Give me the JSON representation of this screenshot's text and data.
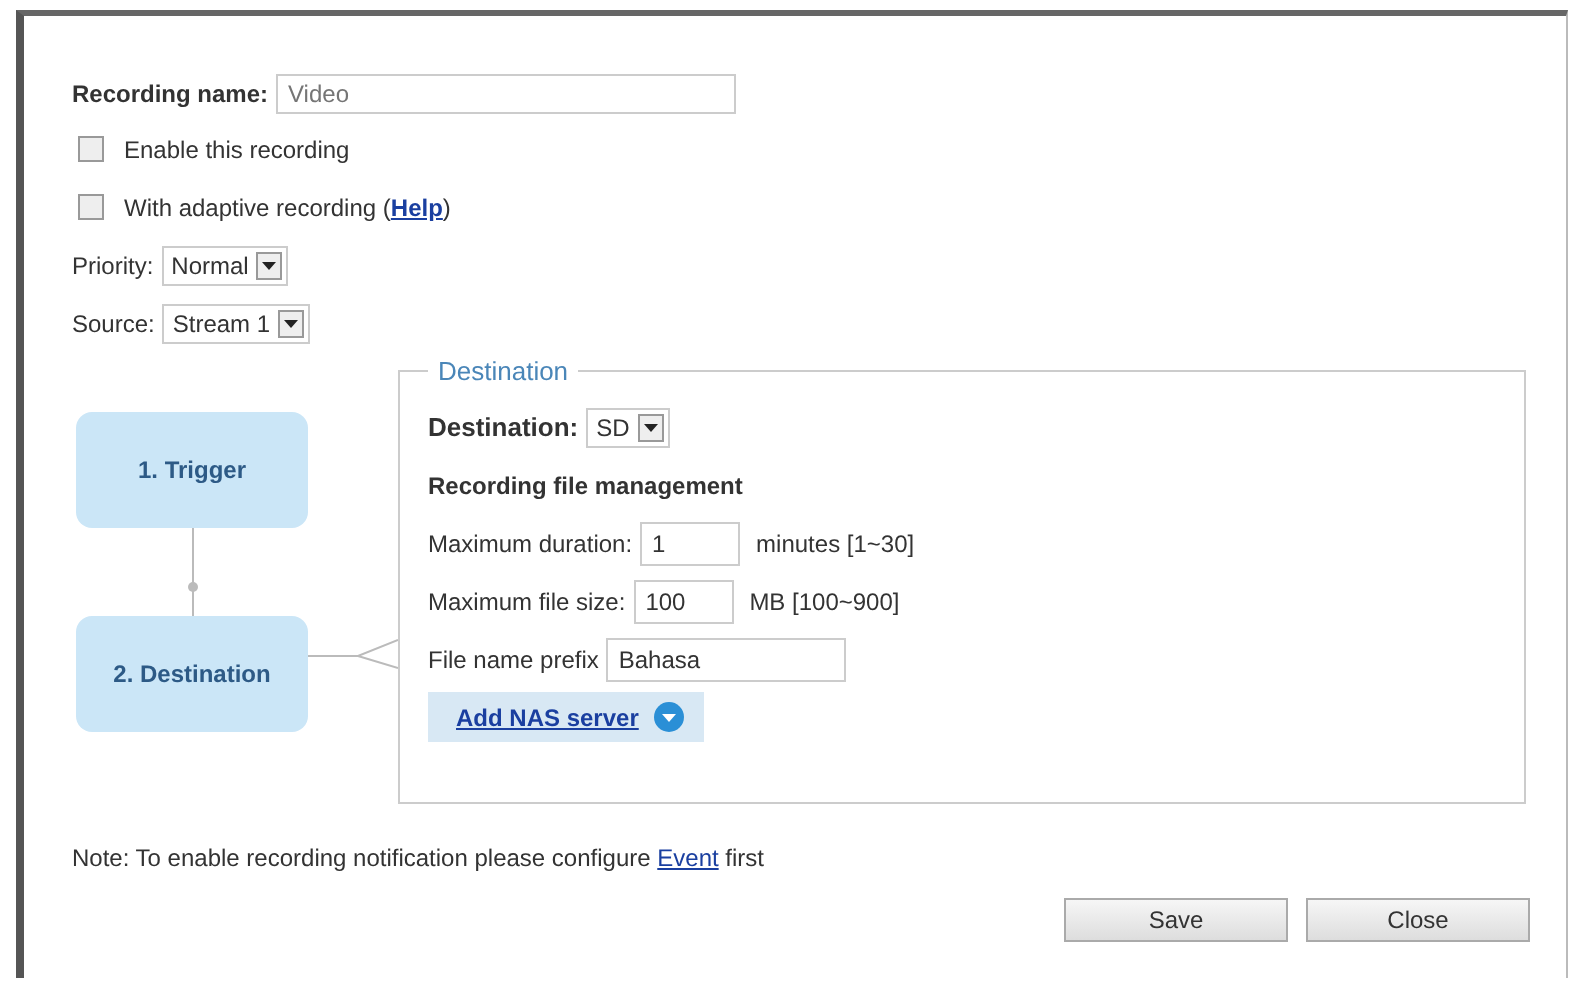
{
  "recording_name": {
    "label": "Recording name:",
    "placeholder": "Video"
  },
  "options": [
    {
      "label_before": "Enable this recording",
      "checked": false
    },
    {
      "label_before": "With adaptive recording (",
      "link": "Help",
      "label_after": ")",
      "checked": false
    }
  ],
  "priority": {
    "label": "Priority:",
    "value": "Normal"
  },
  "source": {
    "label": "Source:",
    "value": "Stream 1"
  },
  "steps": [
    {
      "label": "1. Trigger"
    },
    {
      "label": "2. Destination"
    }
  ],
  "destination": {
    "legend": "Destination",
    "label": "Destination:",
    "value": "SD",
    "section_title": "Recording file management",
    "fields": [
      {
        "label": "Maximum duration:",
        "value": "1",
        "hint": "minutes [1~30]"
      },
      {
        "label": "Maximum file size:",
        "value": "100",
        "hint": "MB [100~900]"
      },
      {
        "label": "File name prefix",
        "value": "Bahasa"
      }
    ],
    "add_button": "Add NAS server"
  },
  "note": {
    "text_before": "Note: To enable recording notification please configure ",
    "link": "Event",
    "text_after": " first"
  },
  "buttons": [
    "Save",
    "Close"
  ]
}
